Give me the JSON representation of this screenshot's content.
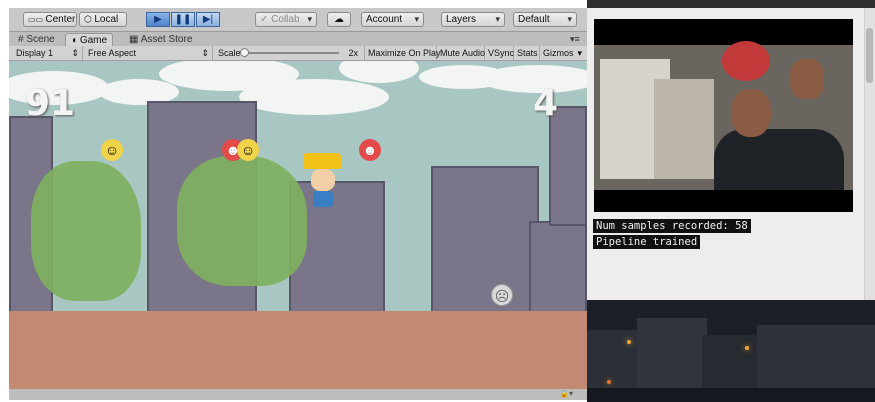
{
  "toolbar": {
    "center_label": "Center",
    "local_label": "Local",
    "play_icon": "play-icon",
    "pause_icon": "pause-icon",
    "step_icon": "step-icon",
    "collab_label": "Collab",
    "cloud_icon": "cloud-icon",
    "account_label": "Account",
    "layers_label": "Layers",
    "layout_label": "Default"
  },
  "tabs": [
    {
      "label": "Scene"
    },
    {
      "label": "Game"
    },
    {
      "label": "Asset Store"
    }
  ],
  "game_bar": {
    "display_label": "Display 1",
    "aspect_label": "Free Aspect",
    "scale_label": "Scale",
    "scale_value": "2x",
    "maximize_label": "Maximize On Play",
    "mute_label": "Mute Audio",
    "vsync_label": "VSync",
    "stats_label": "Stats",
    "gizmos_label": "Gizmos"
  },
  "game": {
    "score_left": "91",
    "score_right": "4"
  },
  "console": {
    "line1": "Num samples recorded: 58",
    "line2": "Pipeline trained"
  },
  "colors": {
    "play_active": "#4f82c8",
    "terminal_bg": "#111111",
    "terminal_fg": "#f2f2f2"
  }
}
